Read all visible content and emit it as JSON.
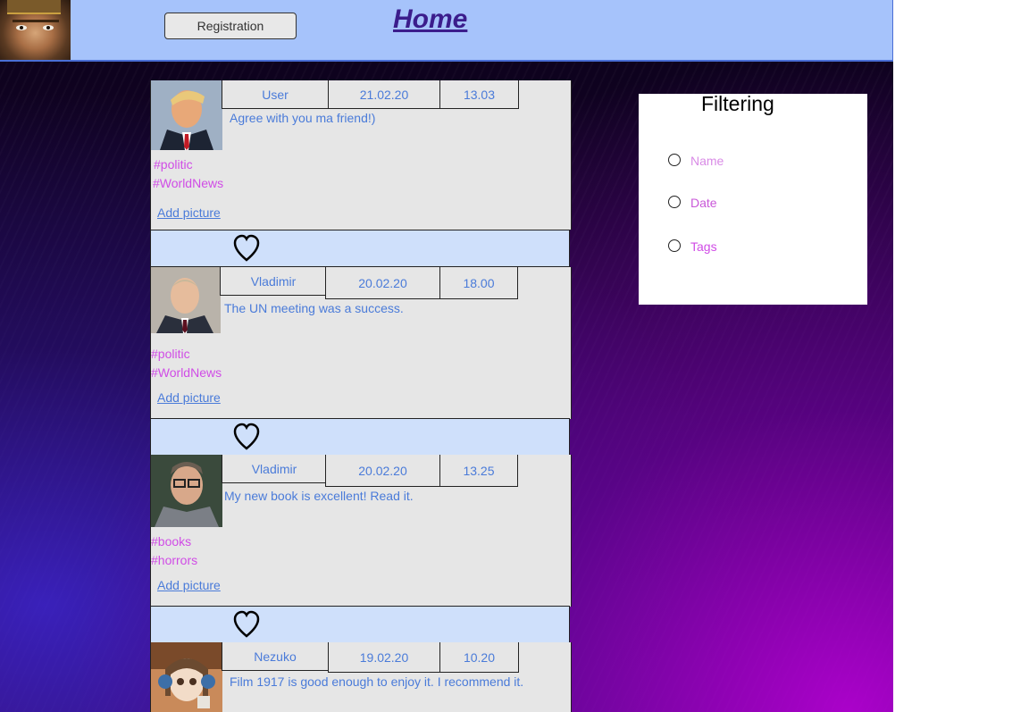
{
  "header": {
    "registration_label": "Registration",
    "home_label": "Home"
  },
  "posts": [
    {
      "author": "User",
      "date": "21.02.20",
      "time": "13.03",
      "text": "Agree with you ma friend!)",
      "tags": [
        "#politic",
        "#WorldNews"
      ],
      "add_picture": "Add picture"
    },
    {
      "author": "Vladimir",
      "date": "20.02.20",
      "time": "18.00",
      "text": "The UN meeting was a success.",
      "tags": [
        "#politic",
        "#WorldNews"
      ],
      "add_picture": "Add picture"
    },
    {
      "author": "Vladimir",
      "date": "20.02.20",
      "time": "13.25",
      "text": "My new book is excellent! Read it.",
      "tags": [
        "#books",
        "#horrors"
      ],
      "add_picture": "Add picture"
    },
    {
      "author": "Nezuko",
      "date": "19.02.20",
      "time": "10.20",
      "text": "Film 1917 is good enough to enjoy it. I recommend it.",
      "tags": [],
      "add_picture": ""
    }
  ],
  "filter": {
    "title": "Filtering",
    "options": [
      "Name",
      "Date",
      "Tags"
    ]
  },
  "colors": {
    "header_bg": "#a6c3fb",
    "home_link": "#3b1d8c",
    "post_text": "#4a7bd9",
    "tag": "#d04ce6",
    "like_bar": "#cfe0fb"
  },
  "icons": [
    "heart-icon",
    "radio-icon"
  ]
}
